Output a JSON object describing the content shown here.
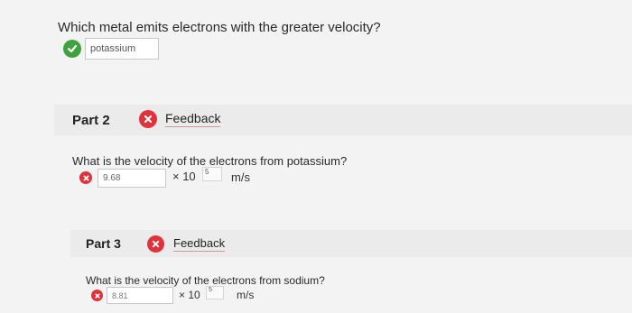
{
  "part1": {
    "question": "Which metal emits electrons with the greater velocity?",
    "answer": "potassium",
    "status_icon": "check-circle-icon",
    "status_color": "#3fa33d"
  },
  "part2": {
    "title": "Part 2",
    "feedback_label": "Feedback",
    "status_icon": "x-circle-icon",
    "status_color": "#e0323a",
    "question": "What is the velocity of the electrons from potassium?",
    "answer": "9.68",
    "times": "× 10",
    "exponent": "5",
    "unit": "m/s"
  },
  "part3": {
    "title": "Part 3",
    "feedback_label": "Feedback",
    "status_icon": "x-circle-icon",
    "question": "What is the velocity of the electrons from sodium?",
    "answer": "8.81",
    "times": "× 10",
    "exponent": "5",
    "unit": "m/s"
  }
}
